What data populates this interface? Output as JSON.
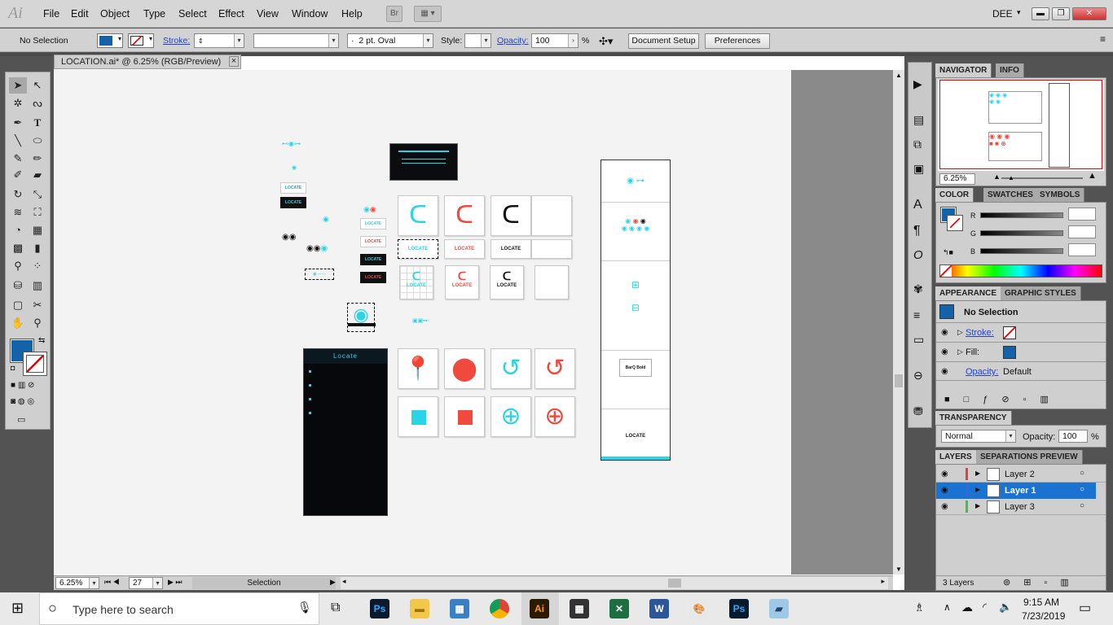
{
  "app": {
    "logo": "Ai",
    "workspace": "DEE",
    "bridge": "Br"
  },
  "menu": [
    "File",
    "Edit",
    "Object",
    "Type",
    "Select",
    "Effect",
    "View",
    "Window",
    "Help"
  ],
  "control": {
    "selection_label": "No Selection",
    "stroke_label": "Stroke:",
    "brush_value": "2 pt. Oval",
    "style_label": "Style:",
    "opacity_label": "Opacity:",
    "opacity_value": "100",
    "percent": "%",
    "doc_setup": "Document Setup",
    "preferences": "Preferences",
    "brush_dot": "·"
  },
  "document": {
    "tab_title": "LOCATION.ai* @ 6.25% (RGB/Preview)",
    "close": "×"
  },
  "status": {
    "zoom": "6.25%",
    "page": "27",
    "tool": "Selection"
  },
  "navigator": {
    "tabs": [
      "NAVIGATOR",
      "INFO"
    ],
    "zoom": "6.25%"
  },
  "color": {
    "tabs": [
      "COLOR",
      "SWATCHES",
      "SYMBOLS"
    ],
    "channels": [
      "R",
      "G",
      "B"
    ],
    "fill_hex": "#1462a8"
  },
  "appearance": {
    "tabs": [
      "APPEARANCE",
      "GRAPHIC STYLES"
    ],
    "title": "No Selection",
    "stroke": "Stroke:",
    "fill": "Fill:",
    "opacity": "Opacity:",
    "opacity_value": "Default"
  },
  "transparency": {
    "tab": "TRANSPARENCY",
    "mode": "Normal",
    "opacity_label": "Opacity:",
    "opacity_value": "100",
    "percent": "%"
  },
  "layers": {
    "tabs": [
      "LAYERS",
      "SEPARATIONS PREVIEW"
    ],
    "items": [
      {
        "name": "Layer 2",
        "color": "#e04040"
      },
      {
        "name": "Layer 1",
        "color": "#4060e0"
      },
      {
        "name": "Layer 3",
        "color": "#40c040"
      }
    ],
    "count": "3 Layers"
  },
  "canvas": {
    "brand": "LOCATE",
    "app_title": "Locate",
    "guide_title": "BarQ Bold"
  },
  "taskbar": {
    "search_placeholder": "Type here to search",
    "time": "9:15 AM",
    "date": "7/23/2019",
    "ps": "Ps",
    "ai": "Ai"
  },
  "accent": {
    "cyan": "#29d4e6",
    "red": "#f04a3e",
    "black": "#111111"
  }
}
